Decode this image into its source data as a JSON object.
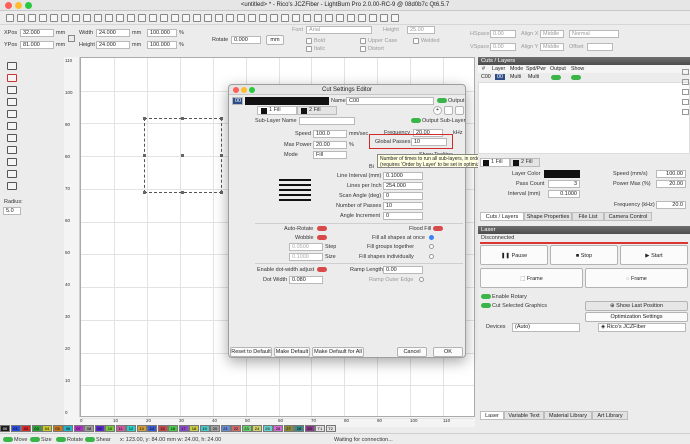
{
  "window": {
    "title": "<untitled> * - Rico's JCZFiber - LightBurn Pro 2.0.00-RC-9 @ 08d0b7c Qt6.5.7"
  },
  "toolbar": {
    "xpos_label": "XPos",
    "xpos_value": "32.000",
    "ypos_label": "YPos",
    "ypos_value": "81.000",
    "unit": "mm",
    "width_label": "Width",
    "width_value": "24.000",
    "height_label": "Height",
    "height_value": "24.000",
    "scale_w": "100.000",
    "scale_h": "100.000",
    "pct": "%",
    "rotate_label": "Rotate",
    "rotate_value": "0.000",
    "mm_btn": "mm",
    "font_label": "Font",
    "font_value": "Arial",
    "height2_label": "Height",
    "height2_value": "25.00",
    "hspace_label": "HSpace",
    "hspace_value": "0.00",
    "vspace_label": "VSpace",
    "vspace_value": "0.00",
    "align_x": "Align X",
    "align_x_value": "Middle",
    "align_y": "Align Y",
    "align_y_value": "Middle",
    "normal": "Normal",
    "offset": "Offset",
    "bold": "Bold",
    "italic": "Italic",
    "upper_case": "Upper Case",
    "distort": "Distort",
    "welded": "Welded"
  },
  "radius": {
    "label": "Radius:",
    "value": "5.0"
  },
  "ruler": {
    "left": [
      "110",
      "100",
      "90",
      "80",
      "70",
      "60",
      "50",
      "40",
      "30",
      "20",
      "10",
      "0"
    ],
    "bottom": [
      "0",
      "10",
      "20",
      "30",
      "40",
      "50",
      "60",
      "70",
      "80",
      "90",
      "100",
      "110"
    ]
  },
  "dialog": {
    "title": "Cut Settings Editor",
    "layer_num": "00",
    "name_label": "Name",
    "name_value": "C00",
    "output_label": "Output",
    "sublayer_tabs": [
      "1 Fill",
      "2 Fill"
    ],
    "sublayer_name_label": "Sub-Layer Name",
    "output_sublayer_label": "Output Sub-Layer",
    "speed_label": "Speed",
    "speed_value": "100.0",
    "speed_unit": "mm/sec",
    "frequency_label": "Frequency",
    "frequency_value": "20.00",
    "frequency_unit": "kHz",
    "maxpower_label": "Max Power",
    "maxpower_value": "20.00",
    "maxpower_unit": "%",
    "global_passes_label": "Global Passes",
    "global_passes_value": "10",
    "mode_label": "Mode",
    "mode_value": "Fill",
    "show_tooltip_text": "Show Tooltips",
    "bi_text": "Bi",
    "tooltip_line1": "Number of times to run all sub-layers, in order",
    "tooltip_line2": "(requires 'Order by Layer' to be set in optimization settings)",
    "line_interval_label": "Line Interval (mm)",
    "line_interval_value": "0.1000",
    "lpi_label": "Lines per Inch",
    "lpi_value": "254.000",
    "scan_angle_label": "Scan Angle (deg)",
    "scan_angle_value": "0",
    "num_passes_label": "Number of Passes",
    "num_passes_value": "10",
    "angle_inc_label": "Angle Increment",
    "angle_inc_value": "0",
    "auto_rotate": "Auto-Rotate",
    "flood_fill": "Flood Fill",
    "wobble": "Wobble",
    "fill_all": "Fill all shapes at once",
    "step_value": "0.0500",
    "step_label": "Step",
    "fill_groups": "Fill groups together",
    "size_value": "0.1000",
    "size_label": "Size",
    "fill_individual": "Fill shapes individually",
    "dot_width_adjust": "Enable dot-width adjust",
    "ramp_length_label": "Ramp Length",
    "ramp_length_value": "0.00",
    "dot_width_label": "Dot Width",
    "dot_width_value": "0.080",
    "ramp_outer": "Ramp Outer Edge",
    "reset_default": "Reset to Default",
    "make_default": "Make Default",
    "make_default_all": "Make Default for All",
    "cancel": "Cancel",
    "ok": "OK"
  },
  "cuts_layers": {
    "header": "Cuts / Layers",
    "columns": [
      "#",
      "Layer",
      "Mode",
      "Spd/Pwr",
      "Output",
      "Show"
    ],
    "row": {
      "num": "C00",
      "layer": "00",
      "mode": "Multi",
      "spd": "Multi"
    },
    "sub_tabs": [
      "1 Fill",
      "2 Fill"
    ],
    "layer_color_label": "Layer Color",
    "pass_count_label": "Pass Count",
    "pass_count_value": "3",
    "interval_label": "Interval (mm)",
    "interval_value": "0.1000",
    "speed_label": "Speed (mm/s)",
    "speed_value": "100.00",
    "power_label": "Power Max (%)",
    "power_value": "20.00",
    "frequency_label": "Frequency (kHz)",
    "frequency_value": "20.0",
    "tabs": [
      "Cuts / Layers",
      "Shape Properties",
      "File List",
      "Camera Control"
    ]
  },
  "laser": {
    "header": "Laser",
    "status": "Disconnected",
    "pause": "Pause",
    "stop": "Stop",
    "start": "Start",
    "frame1": "Frame",
    "frame2": "Frame",
    "enable_rotary": "Enable Rotary",
    "cut_selected": "Cut Selected Graphics",
    "show_last_position": "Show Last Position",
    "optimization_settings": "Optimization Settings",
    "devices_label": "Devices",
    "devices_value": "(Auto)",
    "device_name": "Rico's JCZFiber",
    "bottom_tabs": [
      "Laser",
      "Variable Text",
      "Material Library",
      "Art Library"
    ]
  },
  "palette": [
    "00",
    "01",
    "02",
    "03",
    "04",
    "05",
    "06",
    "07",
    "08",
    "09",
    "10",
    "11",
    "12",
    "13",
    "14",
    "15",
    "16",
    "17",
    "18",
    "19",
    "20",
    "21",
    "22",
    "23",
    "24",
    "25",
    "26",
    "27",
    "28",
    "29",
    "T1",
    "T2"
  ],
  "palette_colors": [
    "#1a1a1a",
    "#2a4bd7",
    "#d42a2a",
    "#2fa336",
    "#c8c82a",
    "#c87a1e",
    "#25b4c8",
    "#b02ec8",
    "#9a9a9a",
    "#5a2ad0",
    "#7ac842",
    "#d05aa0",
    "#2ad0c8",
    "#d0a03a",
    "#3a5ad0",
    "#c84a4a",
    "#4ac84a",
    "#8a4ac8",
    "#c8c84a",
    "#4ac8c8",
    "#a0a0a0",
    "#6a8ad0",
    "#d06a6a",
    "#6ad06a",
    "#d0d06a",
    "#6ad0d0",
    "#d06ad0",
    "#8a8a3a",
    "#3a8a8a",
    "#8a3a8a",
    "#e0e0e0",
    "#e0e0e0"
  ],
  "status": {
    "move": "Move",
    "size": "Size",
    "rotate": "Rotate",
    "shear": "Shear",
    "coords": "x: 123.00, y: 84.00 mm  w: 24.00,  h: 24.00",
    "connection": "Waiting for connection..."
  }
}
